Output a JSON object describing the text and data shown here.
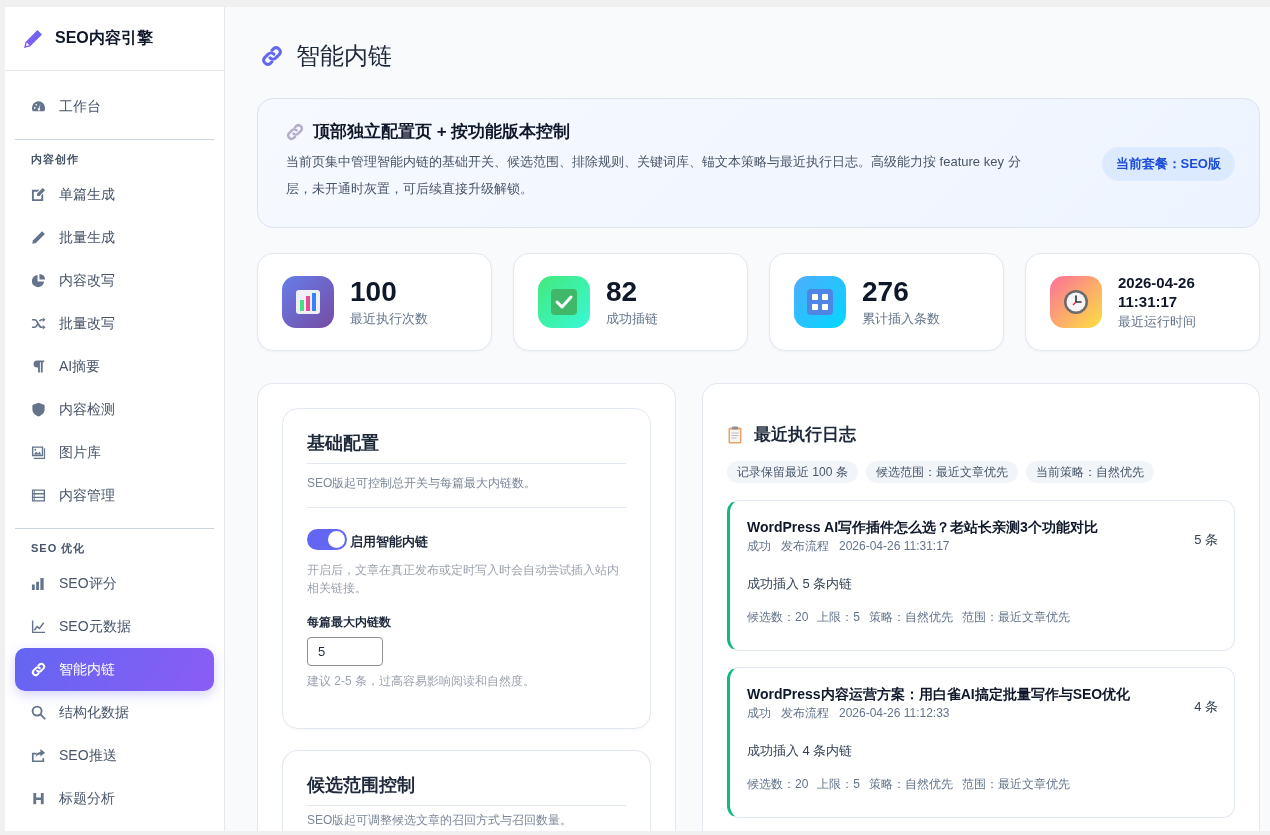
{
  "sidebar": {
    "brand": "SEO内容引擎",
    "sections": [
      {
        "items": [
          {
            "label": "工作台",
            "selected": false
          }
        ]
      },
      {
        "heading": "内容创作",
        "items": [
          {
            "label": "单篇生成",
            "selected": false
          },
          {
            "label": "批量生成",
            "selected": false
          },
          {
            "label": "内容改写",
            "selected": false
          },
          {
            "label": "批量改写",
            "selected": false
          },
          {
            "label": "AI摘要",
            "selected": false
          },
          {
            "label": "内容检测",
            "selected": false
          },
          {
            "label": "图片库",
            "selected": false
          },
          {
            "label": "内容管理",
            "selected": false
          }
        ]
      },
      {
        "heading": "SEO 优化",
        "items": [
          {
            "label": "SEO评分",
            "selected": false
          },
          {
            "label": "SEO元数据",
            "selected": false
          },
          {
            "label": "智能内链",
            "selected": true
          },
          {
            "label": "结构化数据",
            "selected": false
          },
          {
            "label": "SEO推送",
            "selected": false
          },
          {
            "label": "标题分析",
            "selected": false
          }
        ]
      }
    ]
  },
  "page": {
    "title": "智能内链"
  },
  "banner": {
    "title": "顶部独立配置页 + 按功能版本控制",
    "description": "当前页集中管理智能内链的基础开关、候选范围、排除规则、关键词库、锚文本策略与最近执行日志。高级能力按 feature key 分层，未开通时灰置，可后续直接升级解锁。",
    "plan_badge": "当前套餐：SEO版"
  },
  "stats": [
    {
      "kind": "number",
      "value": "100",
      "label": "最近执行次数"
    },
    {
      "kind": "number",
      "value": "82",
      "label": "成功插链"
    },
    {
      "kind": "number",
      "value": "276",
      "label": "累计插入条数"
    },
    {
      "kind": "time",
      "value": "2026-04-26 11:31:17",
      "label": "最近运行时间"
    }
  ],
  "basic_config": {
    "title": "基础配置",
    "description": "SEO版起可控制总开关与每篇最大内链数。",
    "toggle": {
      "label": "启用智能内链",
      "on": true,
      "help": "开启后，文章在真正发布或定时写入时会自动尝试插入站内相关链接。"
    },
    "max_links": {
      "label": "每篇最大内链数",
      "value": "5",
      "hint": "建议 2-5 条，过高容易影响阅读和自然度。"
    }
  },
  "candidate_scope": {
    "title": "候选范围控制",
    "description": "SEO版起可调整候选文章的召回方式与召回数量。"
  },
  "log": {
    "title": "最近执行日志",
    "tags": [
      "记录保留最近 100 条",
      "候选范围：最近文章优先",
      "当前策略：自然优先"
    ],
    "entries": [
      {
        "title": "WordPress AI写作插件怎么选？老站长亲测3个功能对比",
        "status": "成功",
        "source": "发布流程",
        "time": "2026-04-26 11:31:17",
        "count": "5 条",
        "summary": "成功插入 5 条内链",
        "details": [
          "候选数：20",
          "上限：5",
          "策略：自然优先",
          "范围：最近文章优先"
        ]
      },
      {
        "title": "WordPress内容运营方案：用白雀AI搞定批量写作与SEO优化",
        "status": "成功",
        "source": "发布流程",
        "time": "2026-04-26 11:12:33",
        "count": "4 条",
        "summary": "成功插入 4 条内链",
        "details": [
          "候选数：20",
          "上限：5",
          "策略：自然优先",
          "范围：最近文章优先"
        ]
      }
    ]
  }
}
